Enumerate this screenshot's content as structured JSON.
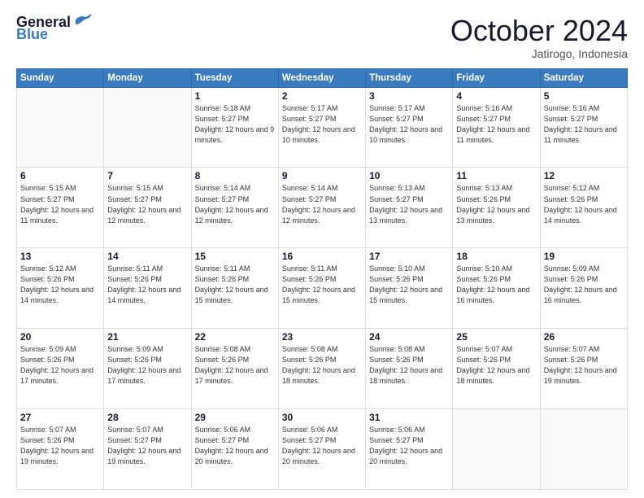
{
  "header": {
    "logo_line1": "General",
    "logo_line2": "Blue",
    "month": "October 2024",
    "location": "Jatirogo, Indonesia"
  },
  "weekdays": [
    "Sunday",
    "Monday",
    "Tuesday",
    "Wednesday",
    "Thursday",
    "Friday",
    "Saturday"
  ],
  "weeks": [
    [
      {
        "day": "",
        "empty": true
      },
      {
        "day": "",
        "empty": true
      },
      {
        "day": "1",
        "rise": "5:18 AM",
        "set": "5:27 PM",
        "daylight": "12 hours and 9 minutes."
      },
      {
        "day": "2",
        "rise": "5:17 AM",
        "set": "5:27 PM",
        "daylight": "12 hours and 10 minutes."
      },
      {
        "day": "3",
        "rise": "5:17 AM",
        "set": "5:27 PM",
        "daylight": "12 hours and 10 minutes."
      },
      {
        "day": "4",
        "rise": "5:16 AM",
        "set": "5:27 PM",
        "daylight": "12 hours and 11 minutes."
      },
      {
        "day": "5",
        "rise": "5:16 AM",
        "set": "5:27 PM",
        "daylight": "12 hours and 11 minutes."
      }
    ],
    [
      {
        "day": "6",
        "rise": "5:15 AM",
        "set": "5:27 PM",
        "daylight": "12 hours and 11 minutes."
      },
      {
        "day": "7",
        "rise": "5:15 AM",
        "set": "5:27 PM",
        "daylight": "12 hours and 12 minutes."
      },
      {
        "day": "8",
        "rise": "5:14 AM",
        "set": "5:27 PM",
        "daylight": "12 hours and 12 minutes."
      },
      {
        "day": "9",
        "rise": "5:14 AM",
        "set": "5:27 PM",
        "daylight": "12 hours and 12 minutes."
      },
      {
        "day": "10",
        "rise": "5:13 AM",
        "set": "5:27 PM",
        "daylight": "12 hours and 13 minutes."
      },
      {
        "day": "11",
        "rise": "5:13 AM",
        "set": "5:26 PM",
        "daylight": "12 hours and 13 minutes."
      },
      {
        "day": "12",
        "rise": "5:12 AM",
        "set": "5:26 PM",
        "daylight": "12 hours and 14 minutes."
      }
    ],
    [
      {
        "day": "13",
        "rise": "5:12 AM",
        "set": "5:26 PM",
        "daylight": "12 hours and 14 minutes."
      },
      {
        "day": "14",
        "rise": "5:11 AM",
        "set": "5:26 PM",
        "daylight": "12 hours and 14 minutes."
      },
      {
        "day": "15",
        "rise": "5:11 AM",
        "set": "5:26 PM",
        "daylight": "12 hours and 15 minutes."
      },
      {
        "day": "16",
        "rise": "5:11 AM",
        "set": "5:26 PM",
        "daylight": "12 hours and 15 minutes."
      },
      {
        "day": "17",
        "rise": "5:10 AM",
        "set": "5:26 PM",
        "daylight": "12 hours and 15 minutes."
      },
      {
        "day": "18",
        "rise": "5:10 AM",
        "set": "5:26 PM",
        "daylight": "12 hours and 16 minutes."
      },
      {
        "day": "19",
        "rise": "5:09 AM",
        "set": "5:26 PM",
        "daylight": "12 hours and 16 minutes."
      }
    ],
    [
      {
        "day": "20",
        "rise": "5:09 AM",
        "set": "5:26 PM",
        "daylight": "12 hours and 17 minutes."
      },
      {
        "day": "21",
        "rise": "5:09 AM",
        "set": "5:26 PM",
        "daylight": "12 hours and 17 minutes."
      },
      {
        "day": "22",
        "rise": "5:08 AM",
        "set": "5:26 PM",
        "daylight": "12 hours and 17 minutes."
      },
      {
        "day": "23",
        "rise": "5:08 AM",
        "set": "5:26 PM",
        "daylight": "12 hours and 18 minutes."
      },
      {
        "day": "24",
        "rise": "5:08 AM",
        "set": "5:26 PM",
        "daylight": "12 hours and 18 minutes."
      },
      {
        "day": "25",
        "rise": "5:07 AM",
        "set": "5:26 PM",
        "daylight": "12 hours and 18 minutes."
      },
      {
        "day": "26",
        "rise": "5:07 AM",
        "set": "5:26 PM",
        "daylight": "12 hours and 19 minutes."
      }
    ],
    [
      {
        "day": "27",
        "rise": "5:07 AM",
        "set": "5:26 PM",
        "daylight": "12 hours and 19 minutes."
      },
      {
        "day": "28",
        "rise": "5:07 AM",
        "set": "5:27 PM",
        "daylight": "12 hours and 19 minutes."
      },
      {
        "day": "29",
        "rise": "5:06 AM",
        "set": "5:27 PM",
        "daylight": "12 hours and 20 minutes."
      },
      {
        "day": "30",
        "rise": "5:06 AM",
        "set": "5:27 PM",
        "daylight": "12 hours and 20 minutes."
      },
      {
        "day": "31",
        "rise": "5:06 AM",
        "set": "5:27 PM",
        "daylight": "12 hours and 20 minutes."
      },
      {
        "day": "",
        "empty": true
      },
      {
        "day": "",
        "empty": true
      }
    ]
  ],
  "labels": {
    "sunrise": "Sunrise:",
    "sunset": "Sunset:",
    "daylight": "Daylight:"
  }
}
